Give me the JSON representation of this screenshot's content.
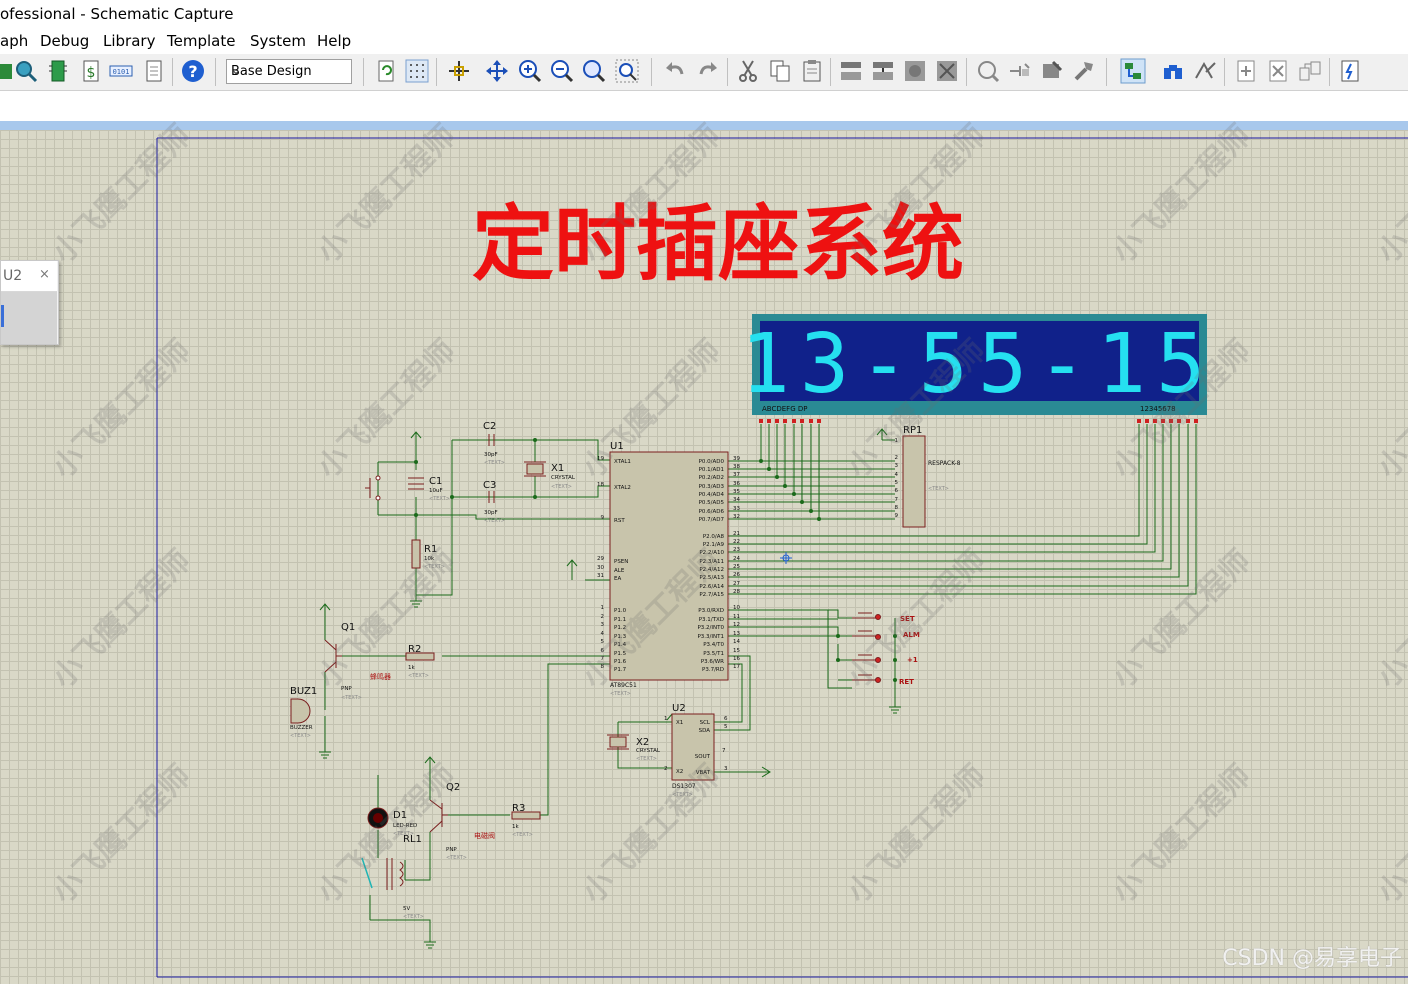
{
  "window": {
    "title": "ofessional - Schematic Capture"
  },
  "menu": [
    "aph",
    "Debug",
    "Library",
    "Template",
    "System",
    "Help"
  ],
  "toolbar": {
    "design_select": "Base Design"
  },
  "panel": {
    "label": "U2",
    "close": "×"
  },
  "schematic": {
    "title": "定时插座系统",
    "display_digits": "13-55-15",
    "display_seg_label": "ABCDEFG  DP",
    "display_dig_label": "12345678",
    "components": {
      "u1_ref": "U1",
      "u1_part": "AT89C51",
      "u2_ref": "U2",
      "u2_part": "DS1307",
      "x1_ref": "X1",
      "x1_part": "CRYSTAL",
      "x2_ref": "X2",
      "x2_part": "CRYSTAL",
      "c1_ref": "C1",
      "c1_val": "10uF",
      "c2_ref": "C2",
      "c2_val": "30pF",
      "c3_ref": "C3",
      "c3_val": "30pF",
      "r1_ref": "R1",
      "r1_val": "10k",
      "r2_ref": "R2",
      "r2_val": "1k",
      "r3_ref": "R3",
      "r3_val": "1k",
      "rp1_ref": "RP1",
      "rp1_part": "RESPACK-8",
      "q1_ref": "Q1",
      "q1_part": "PNP",
      "q2_ref": "Q2",
      "q2_part": "PNP",
      "buz1_ref": "BUZ1",
      "buz1_part": "BUZZER",
      "d1_ref": "D1",
      "d1_part": "LED-RED",
      "rl1_ref": "RL1",
      "rl1_val": "5V",
      "buzzer_label": "蜂鸣器",
      "valve_label": "电磁阀",
      "text_placeholder": "<TEXT>",
      "btn_set": "SET",
      "btn_alm": "ALM",
      "btn_plus": "+1",
      "btn_ret": "RET"
    },
    "u1_pins_left": [
      {
        "num": "19",
        "name": "XTAL1"
      },
      {
        "num": "18",
        "name": "XTAL2"
      },
      {
        "num": "9",
        "name": "RST"
      },
      {
        "num": "29",
        "name": "PSEN"
      },
      {
        "num": "30",
        "name": "ALE"
      },
      {
        "num": "31",
        "name": "EA"
      },
      {
        "num": "1",
        "name": "P1.0"
      },
      {
        "num": "2",
        "name": "P1.1"
      },
      {
        "num": "3",
        "name": "P1.2"
      },
      {
        "num": "4",
        "name": "P1.3"
      },
      {
        "num": "5",
        "name": "P1.4"
      },
      {
        "num": "6",
        "name": "P1.5"
      },
      {
        "num": "7",
        "name": "P1.6"
      },
      {
        "num": "8",
        "name": "P1.7"
      }
    ],
    "u1_pins_right": [
      {
        "num": "39",
        "name": "P0.0/AD0"
      },
      {
        "num": "38",
        "name": "P0.1/AD1"
      },
      {
        "num": "37",
        "name": "P0.2/AD2"
      },
      {
        "num": "36",
        "name": "P0.3/AD3"
      },
      {
        "num": "35",
        "name": "P0.4/AD4"
      },
      {
        "num": "34",
        "name": "P0.5/AD5"
      },
      {
        "num": "33",
        "name": "P0.6/AD6"
      },
      {
        "num": "32",
        "name": "P0.7/AD7"
      },
      {
        "num": "21",
        "name": "P2.0/A8"
      },
      {
        "num": "22",
        "name": "P2.1/A9"
      },
      {
        "num": "23",
        "name": "P2.2/A10"
      },
      {
        "num": "24",
        "name": "P2.3/A11"
      },
      {
        "num": "25",
        "name": "P2.4/A12"
      },
      {
        "num": "26",
        "name": "P2.5/A13"
      },
      {
        "num": "27",
        "name": "P2.6/A14"
      },
      {
        "num": "28",
        "name": "P2.7/A15"
      },
      {
        "num": "10",
        "name": "P3.0/RXD"
      },
      {
        "num": "11",
        "name": "P3.1/TXD"
      },
      {
        "num": "12",
        "name": "P3.2/INT0"
      },
      {
        "num": "13",
        "name": "P3.3/INT1"
      },
      {
        "num": "14",
        "name": "P3.4/T0"
      },
      {
        "num": "15",
        "name": "P3.5/T1"
      },
      {
        "num": "16",
        "name": "P3.6/WR"
      },
      {
        "num": "17",
        "name": "P3.7/RD"
      }
    ],
    "u2_pins": [
      {
        "num": "1",
        "name": "X1"
      },
      {
        "num": "2",
        "name": "X2"
      },
      {
        "num": "6",
        "name": "SCL"
      },
      {
        "num": "5",
        "name": "SDA"
      },
      {
        "num": "7",
        "name": "SOUT"
      },
      {
        "num": "3",
        "name": "VBAT"
      }
    ],
    "rp1_pins": [
      "1",
      "2",
      "3",
      "4",
      "5",
      "6",
      "7",
      "8",
      "9"
    ]
  },
  "watermark": "小飞鹰工程师",
  "footer": "CSDN @易享电子"
}
